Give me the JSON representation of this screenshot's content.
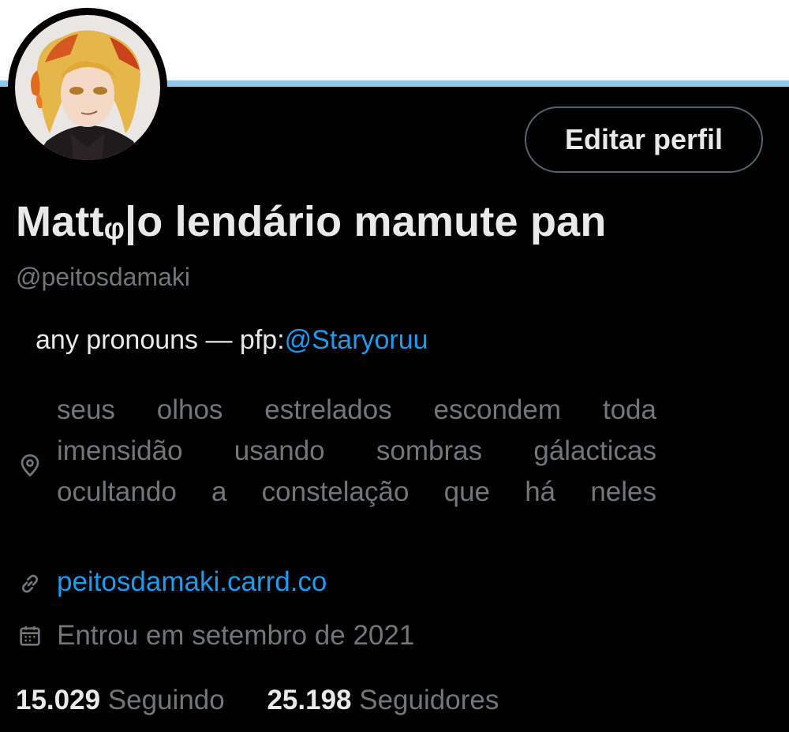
{
  "profile": {
    "display_name": "Mattᵩ|o lendário mamute pan",
    "handle": "@peitosdamaki",
    "edit_button": "Editar perfil",
    "bio": {
      "text": "any pronouns — pfp:",
      "mention": "@Staryoruu"
    },
    "location": {
      "icon": "location-pin-icon",
      "lines": [
        "seus olhos estrelados escondem toda",
        "imensidão usando sombras gálacticas",
        "ocultando a constelação que há neles"
      ]
    },
    "website": {
      "icon": "link-icon",
      "text": "peitosdamaki.carrd.co"
    },
    "joined": {
      "icon": "calendar-icon",
      "text": "Entrou em setembro de 2021"
    },
    "stats": {
      "following_count": "15.029",
      "following_label": "Seguindo",
      "followers_count": "25.198",
      "followers_label": "Seguidores"
    }
  },
  "colors": {
    "background": "#000000",
    "accent": "#1d9bf0",
    "banner_line": "#8fc8ec",
    "text_primary": "#e7e9ea",
    "text_secondary": "#71767b"
  }
}
